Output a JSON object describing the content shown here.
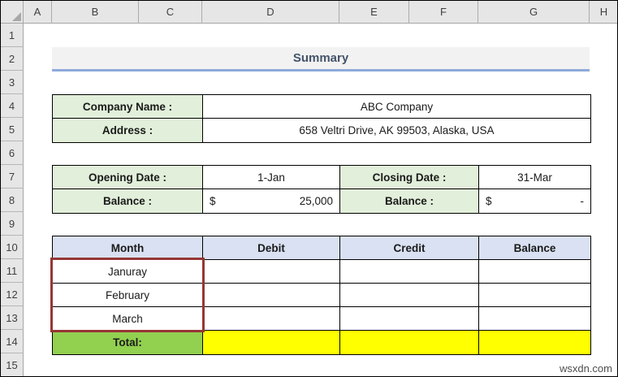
{
  "spreadsheet": {
    "column_headers": [
      "A",
      "B",
      "C",
      "D",
      "E",
      "F",
      "G",
      "H"
    ],
    "row_headers": [
      "1",
      "2",
      "3",
      "4",
      "5",
      "6",
      "7",
      "8",
      "9",
      "10",
      "11",
      "12",
      "13",
      "14",
      "15"
    ]
  },
  "summary": {
    "title": "Summary"
  },
  "company": {
    "name_label": "Company Name :",
    "name_value": "ABC Company",
    "address_label": "Address :",
    "address_value": "658 Veltri Drive, AK 99503, Alaska, USA"
  },
  "dates": {
    "opening_label": "Opening Date :",
    "opening_value": "1-Jan",
    "closing_label": "Closing Date :",
    "closing_value": "31-Mar",
    "opening_balance_label": "Balance :",
    "opening_balance_currency": "$",
    "opening_balance_value": "25,000",
    "closing_balance_label": "Balance :",
    "closing_balance_currency": "$",
    "closing_balance_value": "-"
  },
  "months_table": {
    "headers": [
      "Month",
      "Debit",
      "Credit",
      "Balance"
    ],
    "rows": [
      [
        "Januray",
        "",
        "",
        ""
      ],
      [
        "February",
        "",
        "",
        ""
      ],
      [
        "March",
        "",
        "",
        ""
      ]
    ],
    "total_label": "Total:"
  },
  "colors": {
    "label_green": "#e2efda",
    "table_header_blue": "#d9e1f2",
    "total_green": "#92d050",
    "highlight_yellow": "#ffff00",
    "range_border_red": "#963634",
    "summary_text": "#44546a",
    "summary_underline": "#8eaadb"
  },
  "watermark": {
    "text": "wsxdn.com"
  }
}
